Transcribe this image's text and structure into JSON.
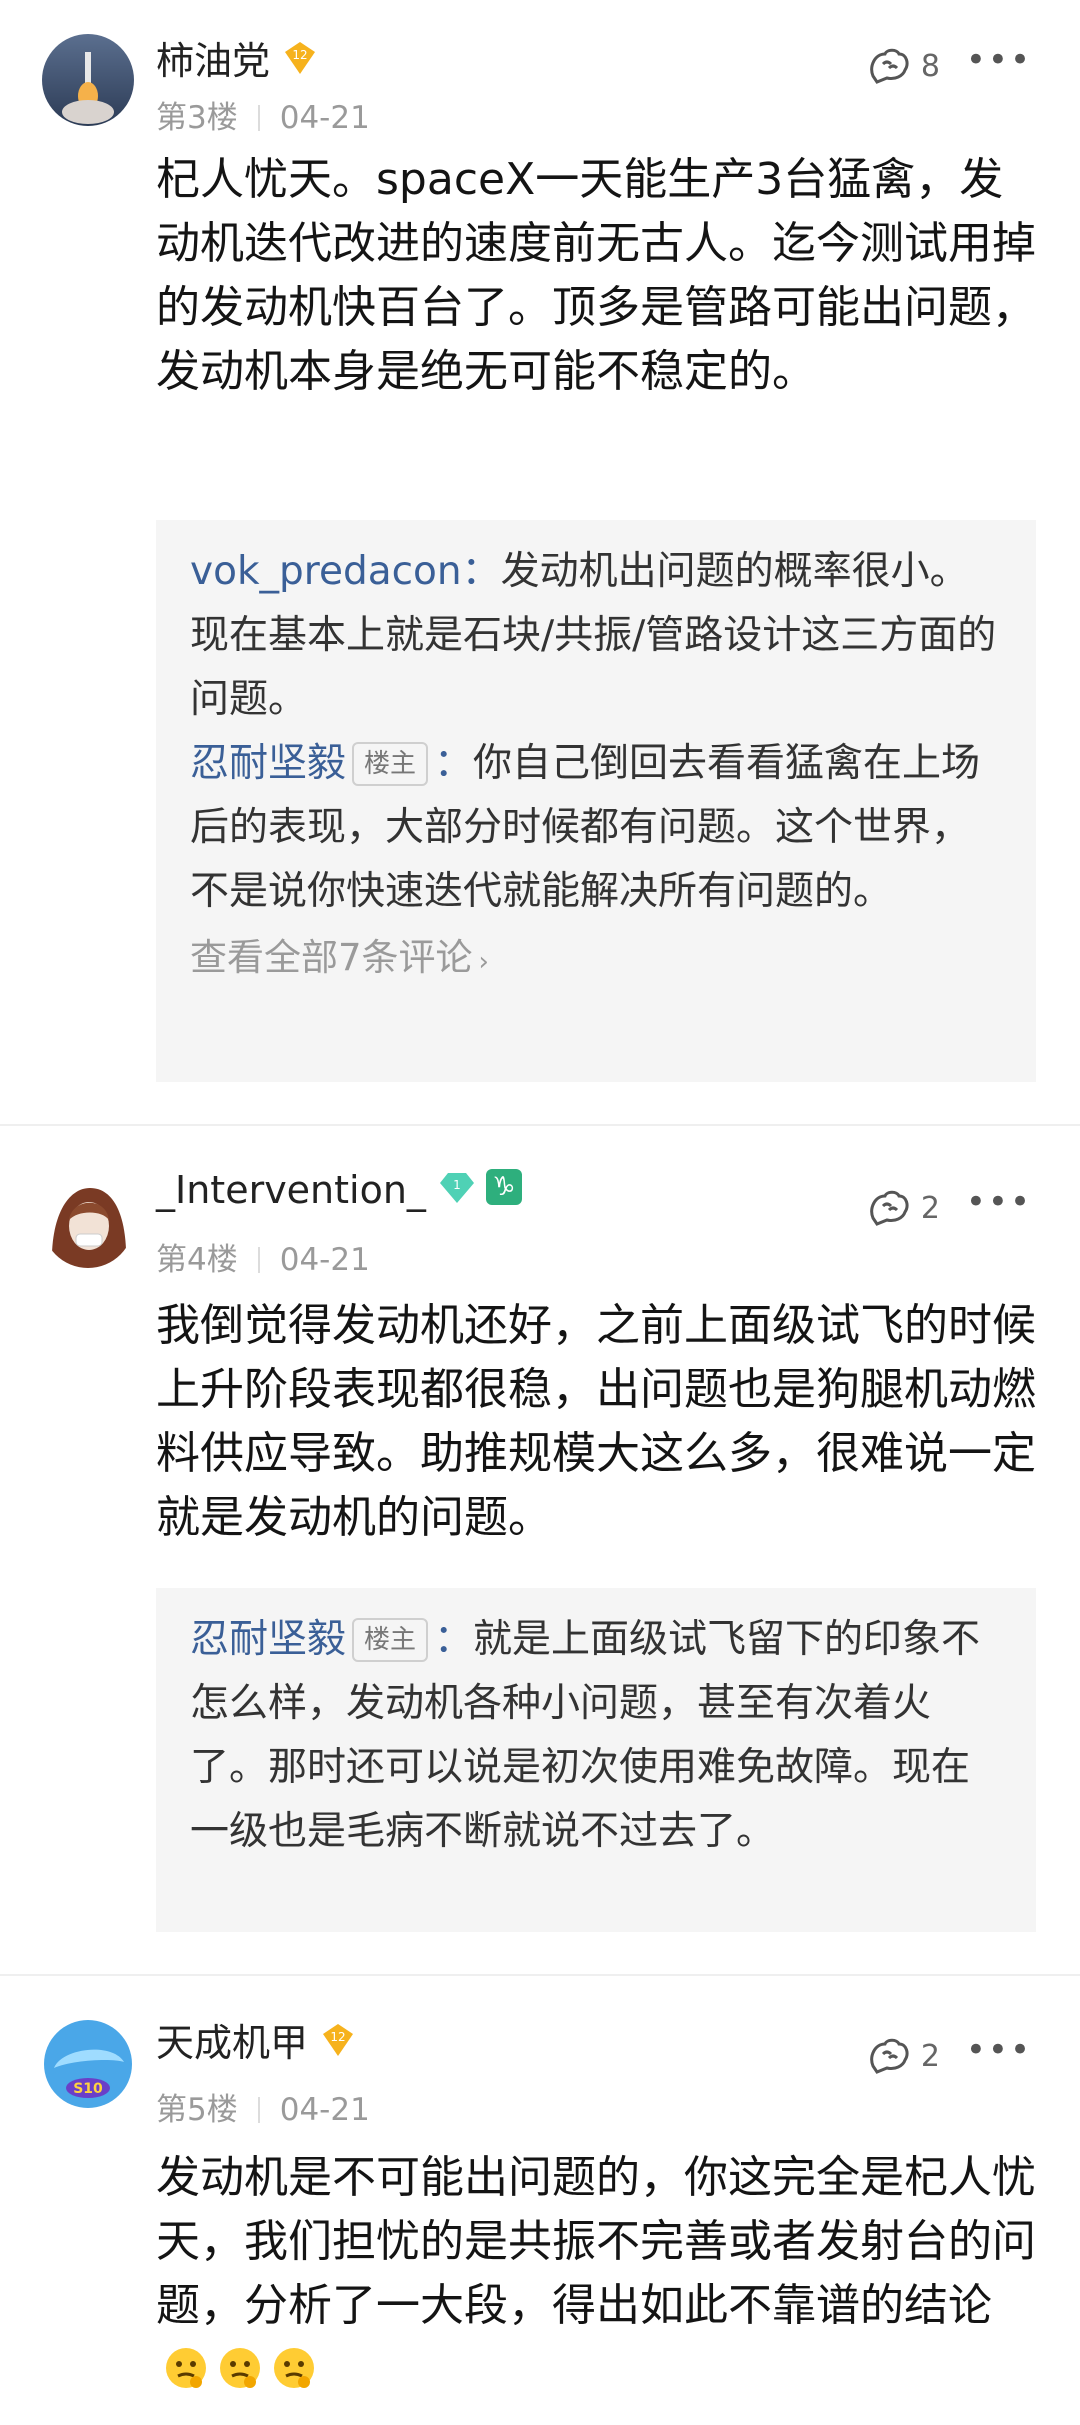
{
  "posts": [
    {
      "username": "柿油党",
      "level": "12",
      "floor": "第3楼",
      "date": "04-21",
      "likes": "8",
      "content": "杞人忧天。spaceX一天能生产3台猛禽，发动机迭代改进的速度前无古人。迄今测试用掉的发动机快百台了。顶多是管路可能出问题，发动机本身是绝无可能不稳定的。",
      "replies": [
        {
          "name": "vok_predacon",
          "op": "",
          "colon": "：",
          "text": "发动机出问题的概率很小。现在基本上就是石块/共振/管路设计这三方面的问题。"
        },
        {
          "name": "忍耐坚毅",
          "op": "楼主",
          "colon": "：",
          "text": "你自己倒回去看看猛禽在上场后的表现，大部分时候都有问题。这个世界，不是说你快速迭代就能解决所有问题的。"
        }
      ],
      "view_all": "查看全部7条评论"
    },
    {
      "username": "_Intervention_",
      "level": "1",
      "zodiac": "♑",
      "floor": "第4楼",
      "date": "04-21",
      "likes": "2",
      "content": "我倒觉得发动机还好，之前上面级试飞的时候上升阶段表现都很稳，出问题也是狗腿机动燃料供应导致。助推规模大这么多，很难说一定就是发动机的问题。",
      "replies": [
        {
          "name": "忍耐坚毅",
          "op": "楼主",
          "colon": "：",
          "text": "就是上面级试飞留下的印象不怎么样，发动机各种小问题，甚至有次着火了。那时还可以说是初次使用难免故障。现在一级也是毛病不断就说不过去了。"
        }
      ]
    },
    {
      "username": "天成机甲",
      "level": "12",
      "avatar_text": "S10",
      "floor": "第5楼",
      "date": "04-21",
      "likes": "2",
      "content": "发动机是不可能出问题的，你这完全是杞人忧天，我们担忧的是共振不完善或者发射台的问题，分析了一大段，得出如此不靠谱的结论"
    }
  ],
  "more_label": "•••",
  "colors": {
    "link": "#3a5f97",
    "level_badge": "#f6b21d",
    "diamond": "#4fd1b5",
    "reply_bg": "#f5f5f5"
  }
}
